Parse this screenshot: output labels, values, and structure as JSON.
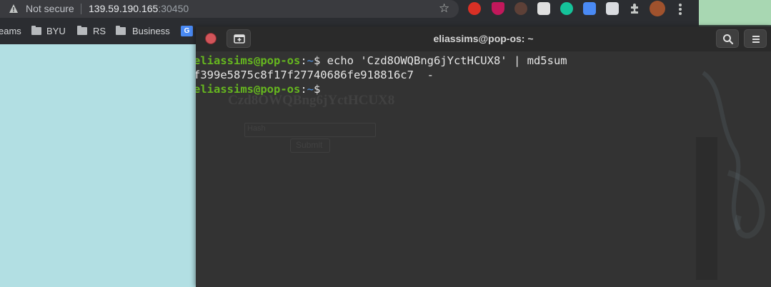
{
  "browser": {
    "security_label": "Not secure",
    "url_host": "139.59.190.165",
    "url_port": ":30450",
    "bookmarks": [
      {
        "label": "eams"
      },
      {
        "label": "BYU"
      },
      {
        "label": "RS"
      },
      {
        "label": "Business"
      }
    ],
    "icons": [
      "warning-icon",
      "star-icon",
      "extension-icon",
      "kebab-menu-icon",
      "folder-icon"
    ],
    "colors": {
      "chrome": "#2b2d31",
      "omnibox": "#3a3b3f",
      "page": "#b2dfe3"
    }
  },
  "terminal": {
    "title": "eliassims@pop-os: ~",
    "lines": [
      {
        "user": "eliassims@pop-os",
        "sep": ":",
        "path": "~",
        "prompt": "$ ",
        "cmd": "echo 'Czd8OWQBng6jYctHCUX8' | md5sum"
      },
      {
        "output": "f399e5875c8f17f27740686fe918816c7  -"
      },
      {
        "user": "eliassims@pop-os",
        "sep": ":",
        "path": "~",
        "prompt": "$ ",
        "cmd": ""
      }
    ],
    "colors": {
      "bg": "#333333",
      "user": "#66b71f",
      "path": "#5294e2",
      "text": "#e6e6e6"
    }
  },
  "background_page": {
    "heading": "Czd8OWQBng6jYctHCUX8",
    "input_placeholder": "Hash",
    "submit_label": "Submit"
  }
}
